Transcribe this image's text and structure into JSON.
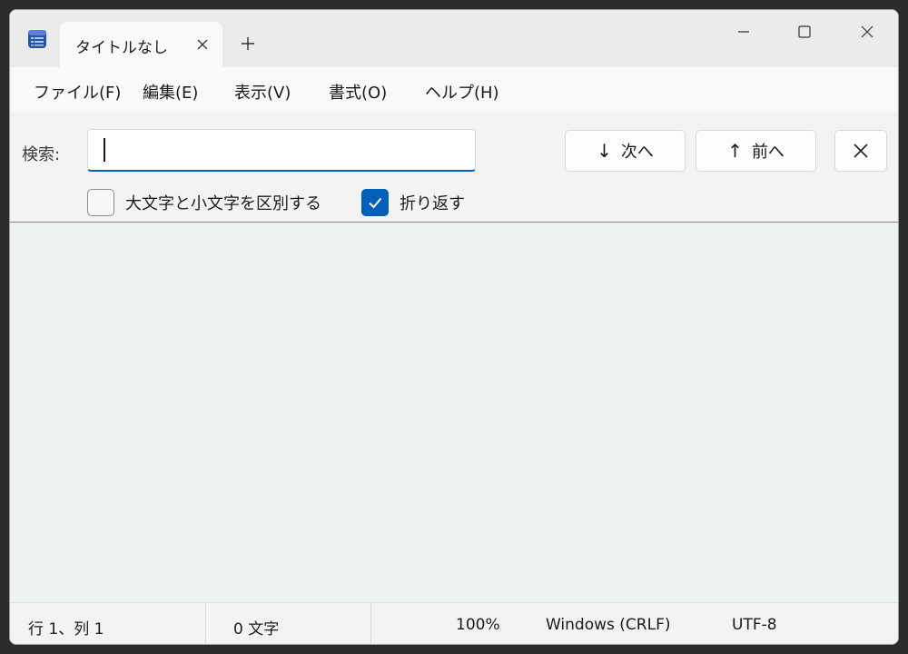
{
  "tab": {
    "title": "タイトルなし"
  },
  "menu": {
    "file": "ファイル(F)",
    "edit": "編集(E)",
    "view": "表示(V)",
    "format": "書式(O)",
    "help": "ヘルプ(H)"
  },
  "find": {
    "label": "検索:",
    "value": "",
    "next_label": "次へ",
    "prev_label": "前へ",
    "match_case_label": "大文字と小文字を区別する",
    "match_case_checked": false,
    "wrap_label": "折り返す",
    "wrap_checked": true
  },
  "status": {
    "position": "行 1、列 1",
    "char_count": "0 文字",
    "zoom": "100%",
    "line_ending": "Windows (CRLF)",
    "encoding": "UTF-8"
  },
  "colors": {
    "accent": "#005fb8",
    "editor_bg": "#ecf3ef"
  },
  "icons": {
    "app": "notepad-icon",
    "tab_close": "close-icon",
    "new_tab": "plus-icon",
    "minimize": "minimize-icon",
    "maximize": "maximize-icon",
    "close": "close-icon",
    "next": "arrow-down-icon",
    "prev": "arrow-up-icon",
    "close_find": "close-icon",
    "check": "checkmark-icon"
  }
}
